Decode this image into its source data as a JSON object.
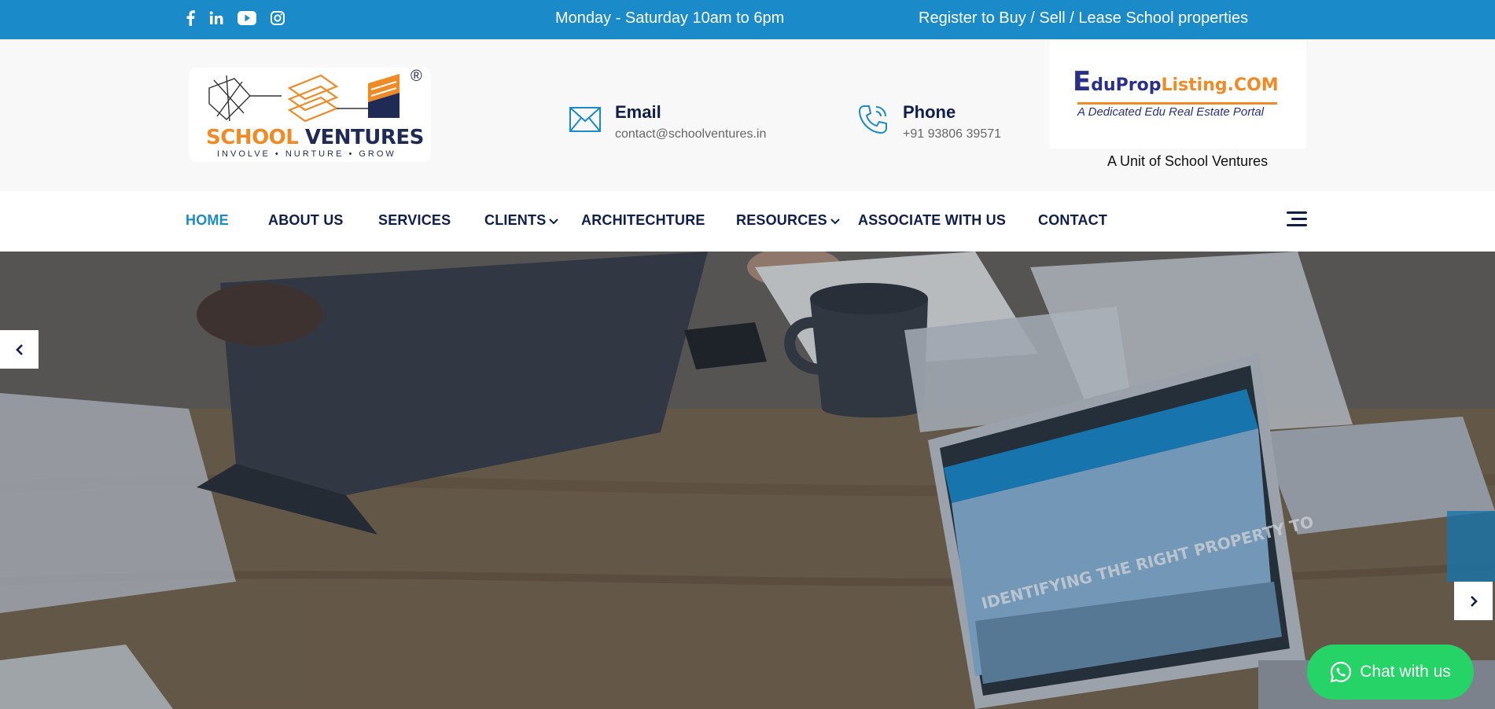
{
  "topbar": {
    "social_icons": [
      "facebook-icon",
      "linkedin-icon",
      "youtube-icon",
      "instagram-icon"
    ],
    "hours": "Monday - Saturday 10am to 6pm",
    "register": "Register to Buy / Sell / Lease School properties"
  },
  "header": {
    "logo": {
      "title_orange": "SCHOOL",
      "title_navy": " VENTURES",
      "tagline": "INVOLVE • NURTURE • GROW",
      "registered": "®"
    },
    "email": {
      "title": "Email",
      "value": "contact@schoolventures.in",
      "icon": "envelope-icon"
    },
    "phone": {
      "title": "Phone",
      "value": "+91 93806 39571",
      "icon": "phone-icon"
    },
    "partner": {
      "logo_e": "E",
      "logo_duprop": "duProp",
      "logo_listing": "Listing.COM",
      "subtitle": "A Dedicated Edu Real Estate Portal",
      "unit_text": "A Unit of School Ventures"
    }
  },
  "nav": {
    "items": [
      {
        "label": "HOME",
        "active": true
      },
      {
        "label": "ABOUT US"
      },
      {
        "label": "SERVICES"
      },
      {
        "label": "CLIENTS",
        "dropdown": true
      },
      {
        "label": "ARCHITECHTURE"
      },
      {
        "label": "RESOURCES",
        "dropdown": true
      },
      {
        "label": "ASSOCIATE WITH US"
      },
      {
        "label": "CONTACT"
      }
    ]
  },
  "chat": {
    "label": "Chat with us",
    "icon": "whatsapp-icon"
  },
  "colors": {
    "brand_blue": "#1a8ac9",
    "navy": "#0f1e4a",
    "orange": "#f08a24",
    "whatsapp_green": "#25d366"
  }
}
